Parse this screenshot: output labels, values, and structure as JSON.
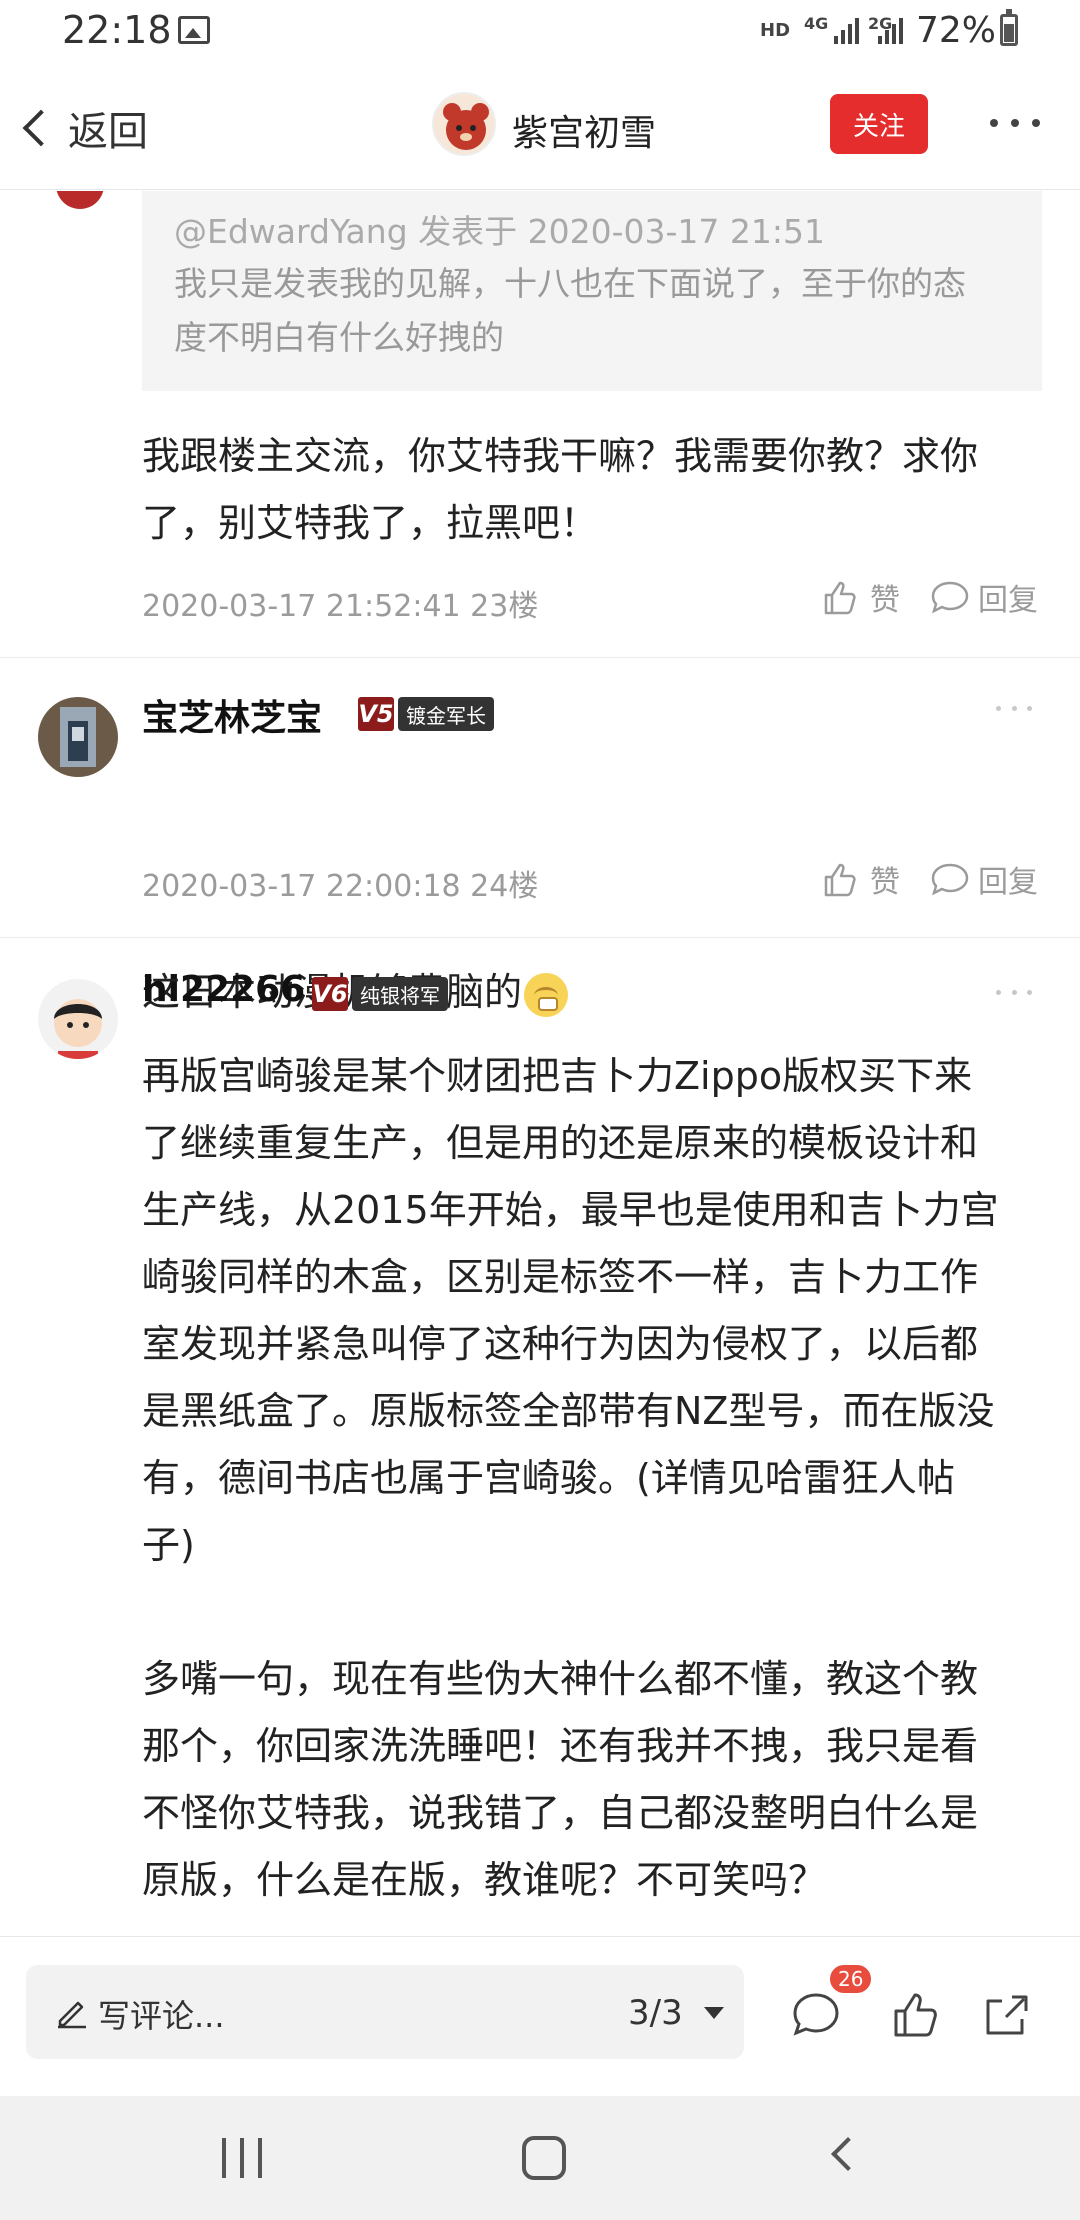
{
  "status_bar": {
    "time": "22:18",
    "hd": "HD",
    "net1": "4G",
    "net2": "2G",
    "battery": "72%"
  },
  "header": {
    "back_label": "返回",
    "author_name": "紫宫初雪",
    "follow_label": "关注"
  },
  "quote": {
    "meta": "@EdwardYang 发表于 2020-03-17 21:51",
    "line1": "我只是发表我的见解，十八也在下面说了，至于你的态",
    "line2": "度不明白有什么好拽的"
  },
  "comments": [
    {
      "lines": [
        "我跟楼主交流，你艾特我干嘛？我需要你教？求你",
        "了，别艾特我了，拉黑吧！"
      ],
      "meta": "2020-03-17 21:52:41  23楼",
      "like_label": "赞",
      "reply_label": "回复"
    },
    {
      "author": "宝芝林芝宝",
      "vip": "V5",
      "rank": "镀金军长",
      "text": "这日本动漫机够费脑的",
      "meta": "2020-03-17 22:00:18  24楼",
      "like_label": "赞",
      "reply_label": "回复"
    },
    {
      "author": "hi22266",
      "vip": "V6",
      "rank": "纯银将军",
      "lines": [
        "再版宫崎骏是某个财团把吉卜力Zippo版权买下来",
        "了继续重复生产，但是用的还是原来的模板设计和",
        "生产线，从2015年开始，最早也是使用和吉卜力宫",
        "崎骏同样的木盒，区别是标签不一样，吉卜力工作",
        "室发现并紧急叫停了这种行为因为侵权了，以后都",
        "是黑纸盒了。原版标签全部带有NZ型号，而在版没",
        "有，德间书店也属于宫崎骏。(详情见哈雷狂人帖",
        "子)",
        "",
        "多嘴一句，现在有些伪大神什么都不懂，教这个教",
        "那个，你回家洗洗睡吧！还有我并不拽，我只是看",
        "不怪你艾特我，说我错了，自己都没整明白什么是",
        "原版，什么是在版，教谁呢？不可笑吗？"
      ]
    }
  ],
  "bottom_bar": {
    "comment_placeholder": "写评论...",
    "page_indicator": "3/3",
    "comment_count": "26"
  },
  "icons": {
    "back": "chevron-left-icon",
    "more": "more-dots-icon",
    "like": "thumbs-up-icon",
    "reply": "speech-bubble-icon",
    "share": "share-icon",
    "edit": "pencil-icon"
  },
  "colors": {
    "follow_button": "#e62d2d",
    "vip_badge": "#8c1c1c",
    "rank_badge": "#333333",
    "comment_badge": "#e84c3d"
  }
}
